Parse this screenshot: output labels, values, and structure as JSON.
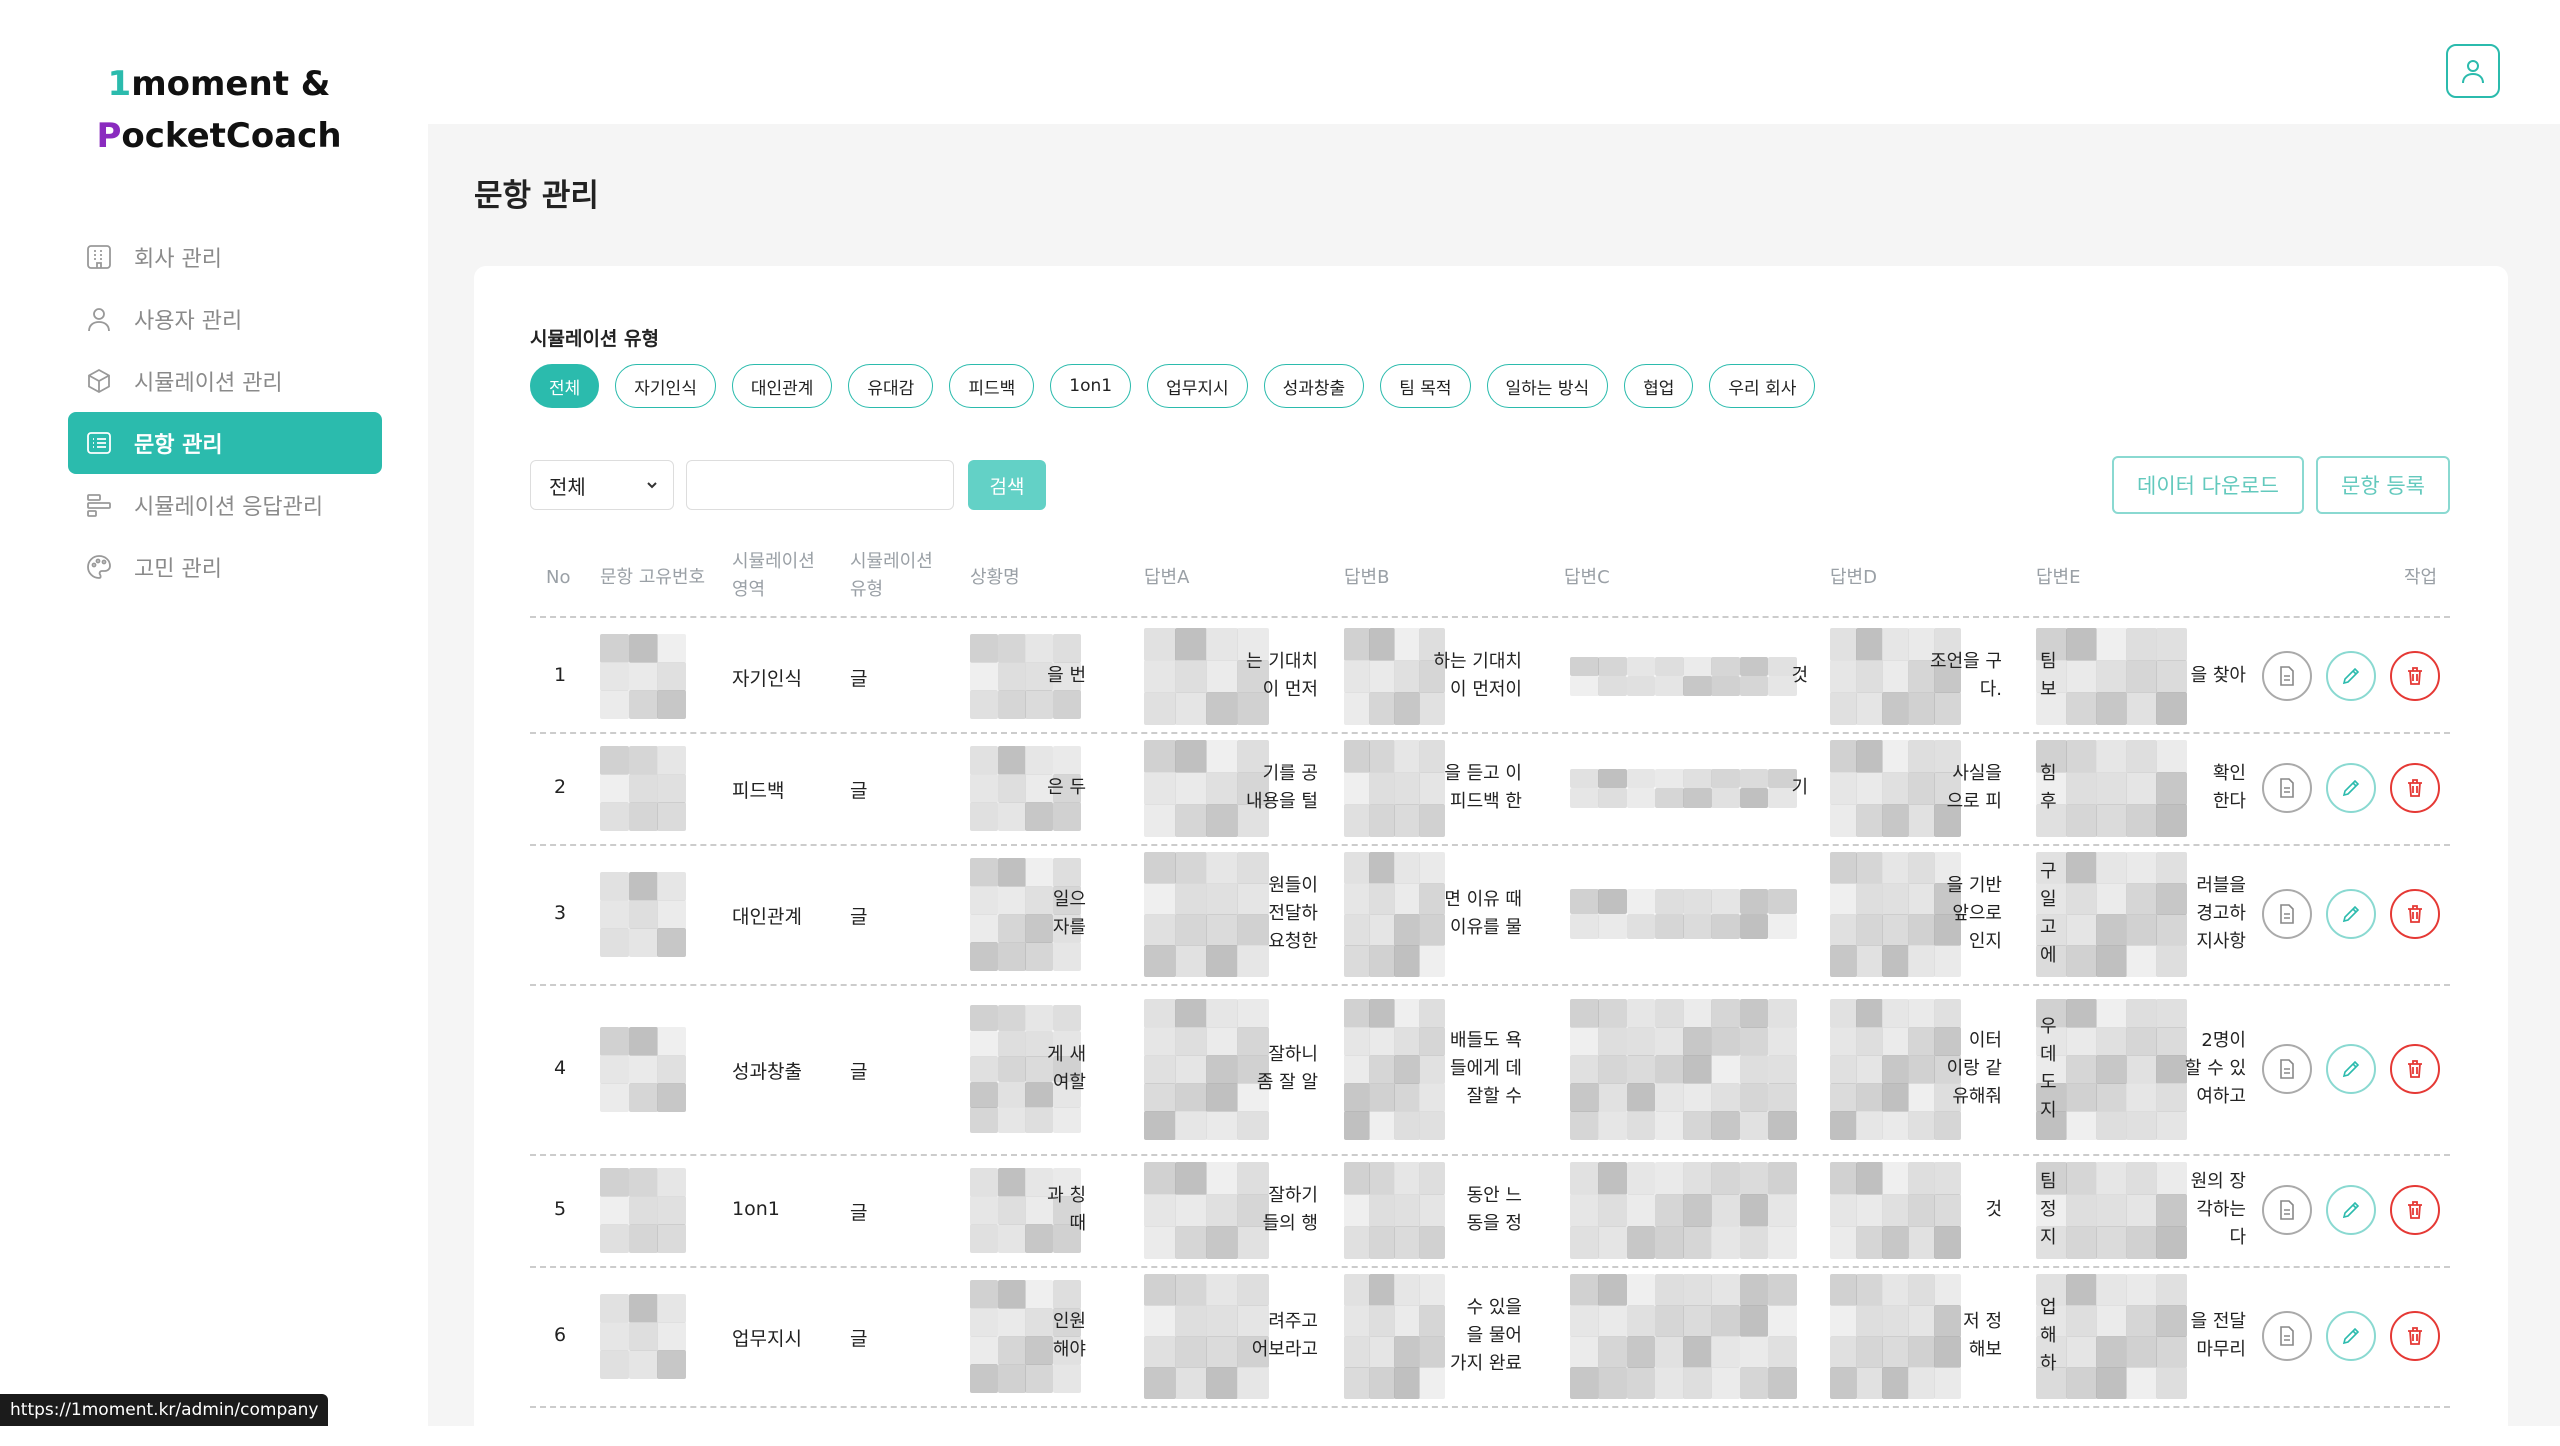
{
  "logo": {
    "line1_accent": "1",
    "line1_rest": "moment &",
    "line2_accent": "P",
    "line2_rest": "ocketCoach"
  },
  "sidebar": {
    "items": [
      {
        "label": "회사 관리",
        "icon": "building-icon",
        "active": false
      },
      {
        "label": "사용자 관리",
        "icon": "user-icon",
        "active": false
      },
      {
        "label": "시뮬레이션 관리",
        "icon": "cube-icon",
        "active": false
      },
      {
        "label": "문항 관리",
        "icon": "list-icon",
        "active": true
      },
      {
        "label": "시뮬레이션 응답관리",
        "icon": "bars-icon",
        "active": false
      },
      {
        "label": "고민 관리",
        "icon": "palette-icon",
        "active": false
      }
    ]
  },
  "header": {
    "title": "문항 관리"
  },
  "filter": {
    "label": "시뮬레이션 유형",
    "chips": [
      "전체",
      "자기인식",
      "대인관계",
      "유대감",
      "피드백",
      "1on1",
      "업무지시",
      "성과창출",
      "팀 목적",
      "일하는 방식",
      "협업",
      "우리 회사"
    ],
    "active_chip": "전체"
  },
  "search": {
    "select_value": "전체",
    "input_value": "",
    "button_label": "검색"
  },
  "buttons": {
    "download": "데이터 다운로드",
    "register": "문항 등록"
  },
  "table": {
    "headers": {
      "no": "No",
      "id": "문항 고유번호",
      "area1": "시뮬레이션",
      "area2": "영역",
      "type1": "시뮬레이션",
      "type2": "유형",
      "situation": "상황명",
      "a": "답변A",
      "b": "답변B",
      "c": "답변C",
      "d": "답변D",
      "e": "답변E",
      "action": "작업"
    },
    "rows": [
      {
        "no": "1",
        "area": "자기인식",
        "type": "글",
        "sit": [
          "을 번"
        ],
        "a": [
          "는 기대치",
          "이 먼저"
        ],
        "b": [
          "하는 기대치",
          "이 먼저이"
        ],
        "c": [
          "것"
        ],
        "d": [
          "조언을 구",
          "다."
        ],
        "e_left": [
          "팀",
          "보"
        ],
        "e": [
          "을 찾아"
        ]
      },
      {
        "no": "2",
        "area": "피드백",
        "type": "글",
        "sit": [
          "은 두"
        ],
        "a": [
          "기를 공",
          "내용을 털"
        ],
        "b": [
          "을 듣고 이",
          "피드백 한"
        ],
        "c": [
          "기"
        ],
        "d": [
          "사실을",
          "으로 피"
        ],
        "e_left": [
          "힘",
          "후"
        ],
        "e": [
          "확인",
          "한다"
        ]
      },
      {
        "no": "3",
        "area": "대인관계",
        "type": "글",
        "sit": [
          "일으",
          "자를"
        ],
        "a": [
          "원들이",
          "전달하",
          "요청한"
        ],
        "b": [
          "면 이유 때",
          "이유를 물"
        ],
        "c": [],
        "d": [
          "을 기반",
          "앞으로",
          "인지"
        ],
        "e_left": [
          "구",
          "일",
          "고",
          "에"
        ],
        "e": [
          "러블을",
          "경고하",
          "지사항"
        ]
      },
      {
        "no": "4",
        "area": "성과창출",
        "type": "글",
        "sit": [
          "게 새",
          "여할"
        ],
        "a": [
          "잘하니",
          "좀 잘 알"
        ],
        "b": [
          "배들도 욕",
          "들에게 데",
          "잘할 수"
        ],
        "c": [],
        "d": [
          "이터",
          "이랑 같",
          "유해줘"
        ],
        "e_left": [
          "우",
          "데",
          "도",
          "지"
        ],
        "e": [
          "2명이",
          "할 수 있",
          "여하고"
        ]
      },
      {
        "no": "5",
        "area": "1on1",
        "type": "글",
        "sit": [
          "과 칭",
          "때"
        ],
        "a": [
          "잘하기",
          "들의 행"
        ],
        "b": [
          "동안 느",
          "동을 정"
        ],
        "c": [],
        "d": [
          "것"
        ],
        "e_left": [
          "팀",
          "정",
          "지"
        ],
        "e": [
          "원의 장",
          "각하는",
          "다"
        ]
      },
      {
        "no": "6",
        "area": "업무지시",
        "type": "글",
        "sit": [
          "인원",
          "해야"
        ],
        "a": [
          "려주고",
          "어보라고"
        ],
        "b": [
          "수 있을",
          "을 물어",
          "가지 완료"
        ],
        "c": [],
        "d": [
          "저 정",
          "해보"
        ],
        "e_left": [
          "업",
          "해",
          "하"
        ],
        "e": [
          "을 전달",
          "마무리"
        ]
      }
    ]
  },
  "statusbar": {
    "url": "https://1moment.kr/admin/company"
  }
}
